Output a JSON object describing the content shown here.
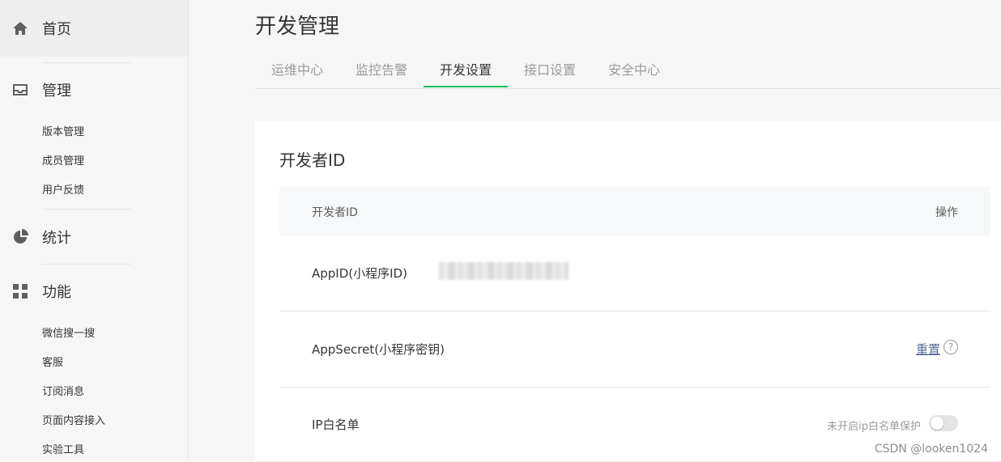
{
  "sidebar": {
    "home_label": "首页",
    "manage": {
      "label": "管理",
      "items": [
        "版本管理",
        "成员管理",
        "用户反馈"
      ]
    },
    "stats_label": "统计",
    "features": {
      "label": "功能",
      "items": [
        "微信搜一搜",
        "客服",
        "订阅消息",
        "页面内容接入",
        "实验工具"
      ]
    }
  },
  "page": {
    "title": "开发管理",
    "tabs": [
      "运维中心",
      "监控告警",
      "开发设置",
      "接口设置",
      "安全中心"
    ],
    "active_tab": "开发设置"
  },
  "card": {
    "title": "开发者ID",
    "header_col1": "开发者ID",
    "header_col2": "操作",
    "rows": {
      "appid_label": "AppID(小程序ID)",
      "appsecret_label": "AppSecret(小程序密钥)",
      "reset_label": "重置",
      "help_glyph": "?",
      "ip_whitelist_label": "IP白名单",
      "ip_toggle_text": "未开启ip白名单保护",
      "ip_toggle_on": false
    }
  },
  "watermark": "CSDN @looken1024",
  "colors": {
    "accent": "#07c160",
    "link": "#576b95"
  },
  "icons": {
    "home": "home-icon",
    "manage": "inbox-icon",
    "stats": "pie-chart-icon",
    "features": "grid-icon"
  }
}
